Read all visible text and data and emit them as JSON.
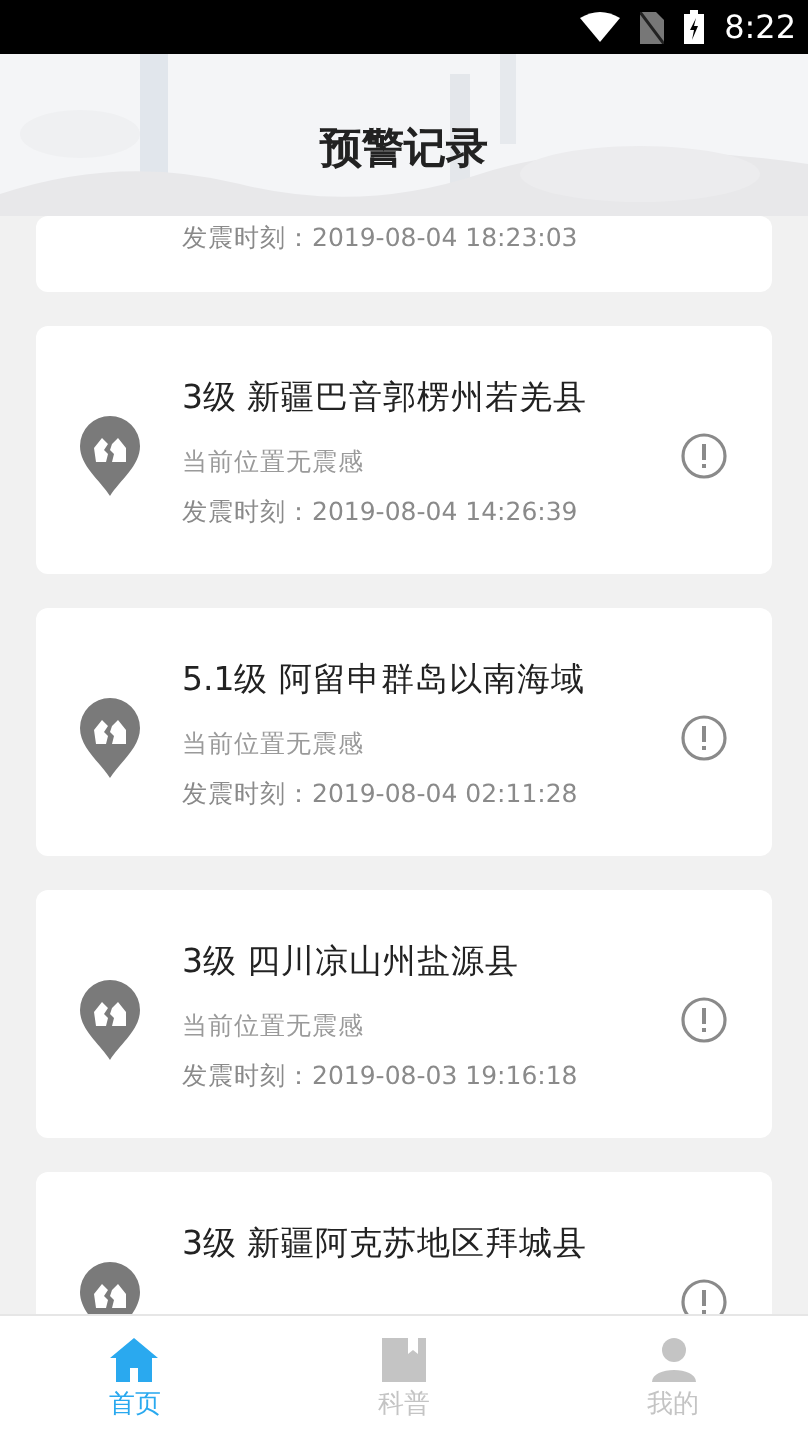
{
  "status_bar": {
    "time": "8:22"
  },
  "header": {
    "title": "预警记录"
  },
  "records": [
    {
      "time": "发震时刻：2019-08-04 18:23:03"
    },
    {
      "title": "3级 新疆巴音郭楞州若羌县",
      "felt": "当前位置无震感",
      "time": "发震时刻：2019-08-04 14:26:39"
    },
    {
      "title": "5.1级 阿留申群岛以南海域",
      "felt": "当前位置无震感",
      "time": "发震时刻：2019-08-04 02:11:28"
    },
    {
      "title": "3级 四川凉山州盐源县",
      "felt": "当前位置无震感",
      "time": "发震时刻：2019-08-03 19:16:18"
    },
    {
      "title": "3级 新疆阿克苏地区拜城县"
    }
  ],
  "tab_bar": [
    {
      "label": "首页",
      "kind": "home",
      "selected": true
    },
    {
      "label": "科普",
      "kind": "book",
      "selected": false
    },
    {
      "label": "我的",
      "kind": "person",
      "selected": false
    }
  ]
}
